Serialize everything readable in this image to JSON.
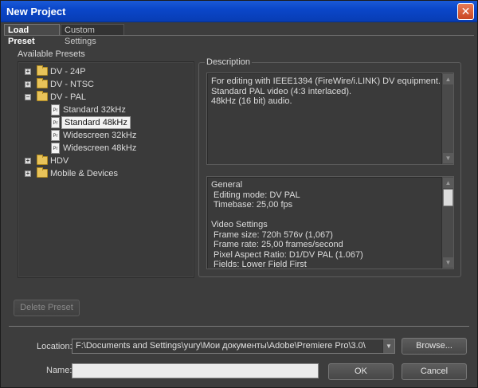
{
  "window": {
    "title": "New Project",
    "close_glyph": "✕"
  },
  "tabs": [
    {
      "label": "Load Preset",
      "active": true
    },
    {
      "label": "Custom Settings",
      "active": false
    }
  ],
  "presets": {
    "label": "Available Presets",
    "tree": [
      {
        "label": "DV - 24P",
        "expander": "+"
      },
      {
        "label": "DV - NTSC",
        "expander": "+"
      },
      {
        "label": "DV - PAL",
        "expander": "−"
      },
      {
        "label": "Standard 32kHz",
        "icon": "Pr"
      },
      {
        "label": "Standard 48kHz",
        "icon": "Pr",
        "selected": true
      },
      {
        "label": "Widescreen 32kHz",
        "icon": "Pr"
      },
      {
        "label": "Widescreen 48kHz",
        "icon": "Pr"
      },
      {
        "label": "HDV",
        "expander": "+"
      },
      {
        "label": "Mobile & Devices",
        "expander": "+"
      }
    ],
    "delete_button": "Delete Preset"
  },
  "description": {
    "label": "Description",
    "text": "For editing with IEEE1394 (FireWire/i.LINK) DV equipment.\nStandard PAL video (4:3 interlaced).\n48kHz (16 bit) audio."
  },
  "details": {
    "text": "General\n Editing mode: DV PAL\n Timebase: 25,00 fps\n\nVideo Settings\n Frame size: 720h 576v (1,067)\n Frame rate: 25,00 frames/second\n Pixel Aspect Ratio: D1/DV PAL (1.067)\n Fields: Lower Field First"
  },
  "footer": {
    "location_label": "Location:",
    "location_value": "F:\\Documents and Settings\\yury\\Мои документы\\Adobe\\Premiere Pro\\3.0\\",
    "browse_button": "Browse...",
    "name_label": "Name:",
    "name_value": "",
    "ok_button": "OK",
    "cancel_button": "Cancel"
  },
  "colors": {
    "titlebar": "#0a46c9",
    "background": "#3d3d3d",
    "selection": "#f2f2f2"
  }
}
